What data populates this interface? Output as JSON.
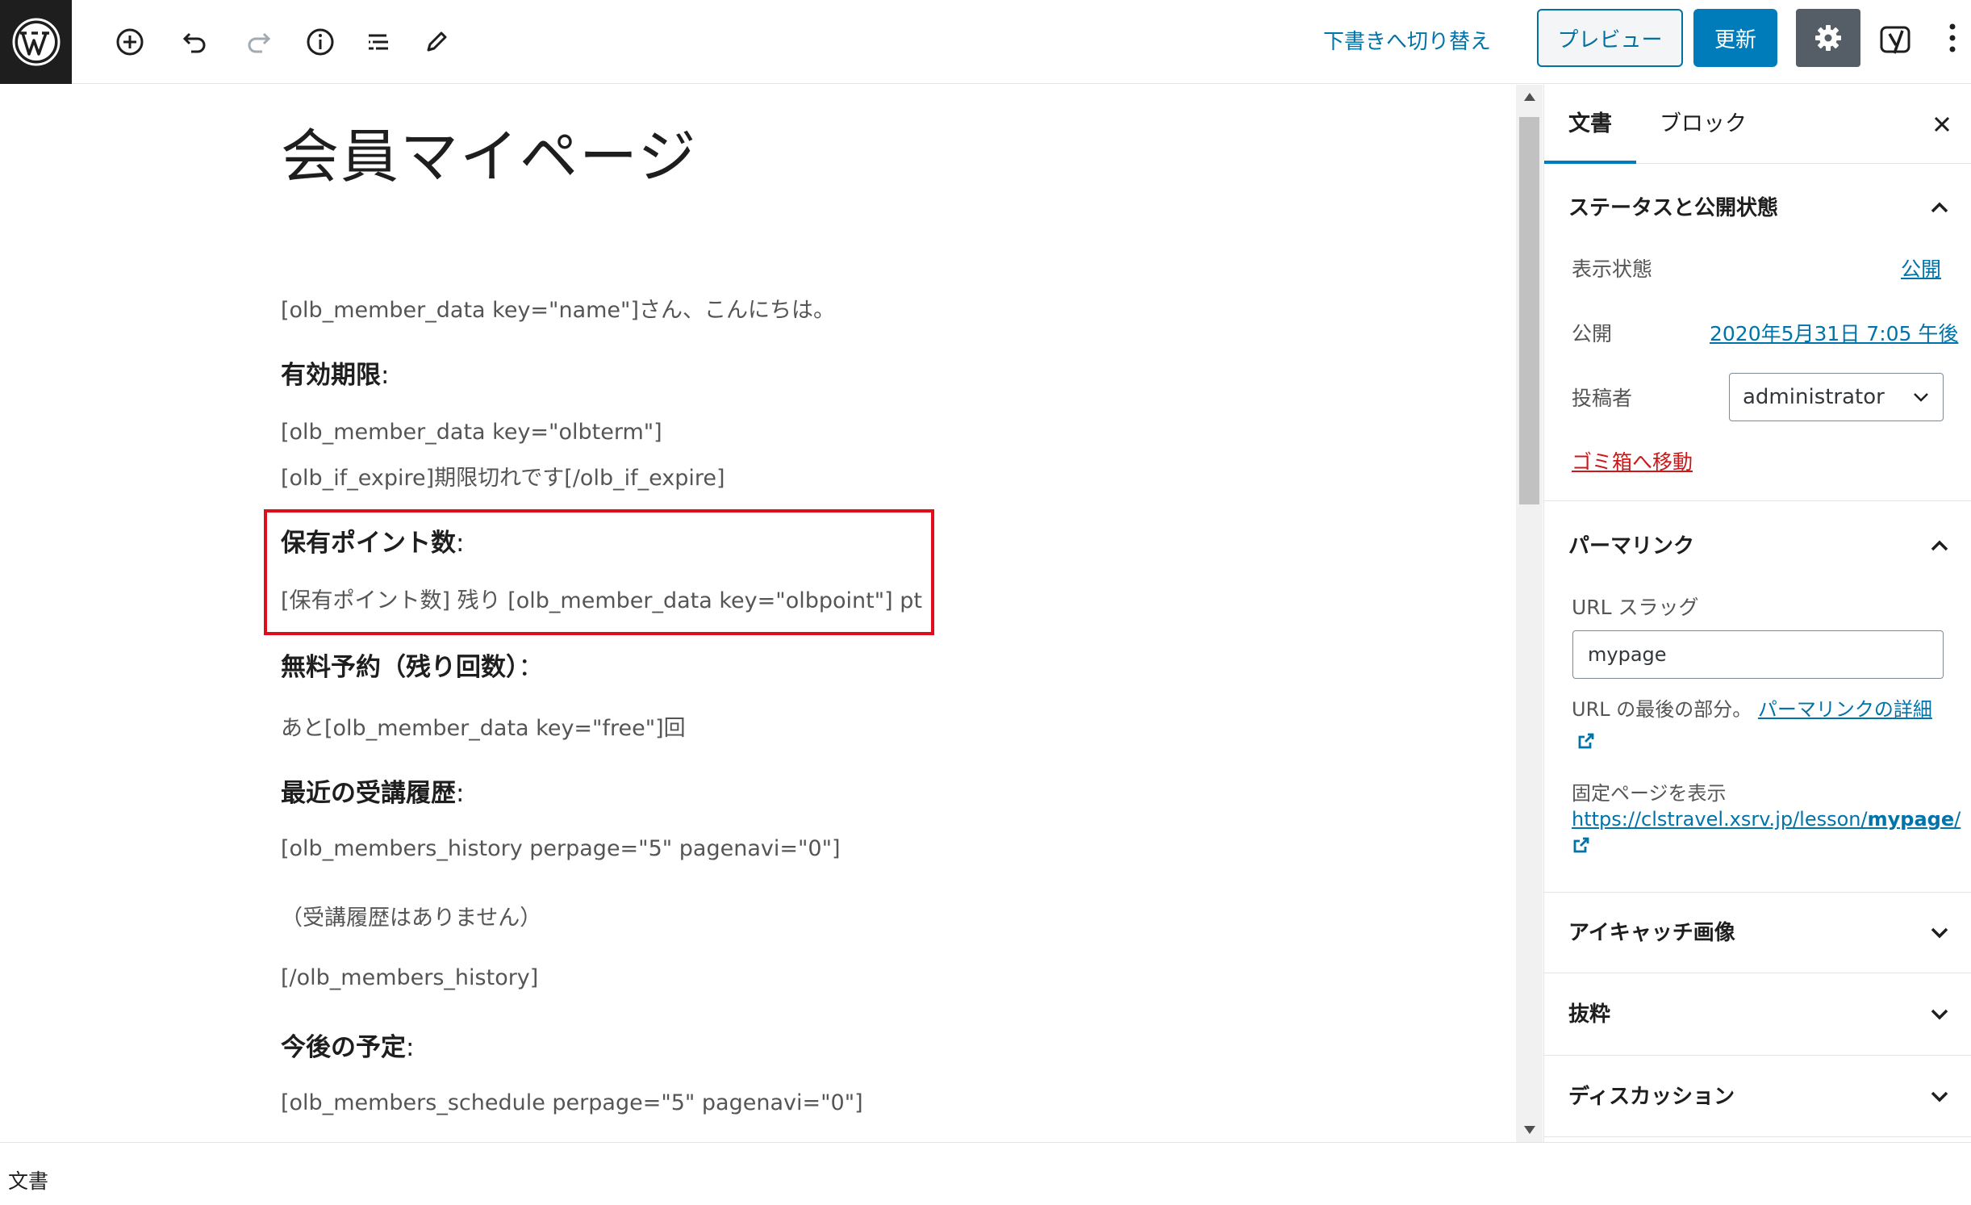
{
  "toolbar": {
    "logo_icon": "wordpress-logo",
    "tools": [
      "add-block-icon",
      "undo-icon",
      "redo-icon",
      "info-icon",
      "block-navigation-icon",
      "tools-edit-icon"
    ],
    "switch_draft": "下書きへ切り替え",
    "preview": "プレビュー",
    "update": "更新",
    "settings_icon": "gear-icon",
    "yoast_icon": "yoast-icon",
    "more_icon": "more-vertical-icon",
    "accent_color": "#007cba"
  },
  "editor": {
    "title": "会員マイページ",
    "greeting": "[olb_member_data key=\"name\"]さん、こんにちは。",
    "expiry_heading": "有効期限",
    "expiry_line1": "[olb_member_data key=\"olbterm\"]",
    "expiry_line2": "[olb_if_expire]期限切れです[/olb_if_expire]",
    "points_heading": "保有ポイント数",
    "points_line": "[保有ポイント数] 残り [olb_member_data key=\"olbpoint\"] pt",
    "free_heading": "無料予約（残り回数）",
    "free_line": "あと[olb_member_data key=\"free\"]回",
    "history_heading": "最近の受講履歴",
    "history_line1": "[olb_members_history perpage=\"5\" pagenavi=\"0\"]",
    "history_line2": "（受講履歴はありません）",
    "history_line3": "[/olb_members_history]",
    "schedule_heading": "今後の予定",
    "schedule_line1": "[olb_members_schedule perpage=\"5\" pagenavi=\"0\"]",
    "colon": ":",
    "colon_fw": "："
  },
  "sidebar": {
    "tab_document": "文書",
    "tab_block": "ブロック",
    "status_panel": "ステータスと公開状態",
    "visibility_label": "表示状態",
    "visibility_value": "公開",
    "publish_label": "公開",
    "publish_value": "2020年5月31日 7:05 午後",
    "author_label": "投稿者",
    "author_value": "administrator",
    "trash": "ゴミ箱へ移動",
    "permalink_panel": "パーマリンク",
    "slug_label": "URL スラッグ",
    "slug_value": "mypage",
    "slug_help": "URL の最後の部分。",
    "slug_help_link": "パーマリンクの詳細",
    "view_page_label": "固定ページを表示",
    "view_page_url_base": "https://clstravel.xsrv.jp/lesson/",
    "view_page_url_slug": "mypage",
    "view_page_url_end": "/",
    "featured_image_panel": "アイキャッチ画像",
    "excerpt_panel": "抜粋",
    "discussion_panel": "ディスカッション"
  },
  "footer": {
    "breadcrumb": "文書"
  }
}
